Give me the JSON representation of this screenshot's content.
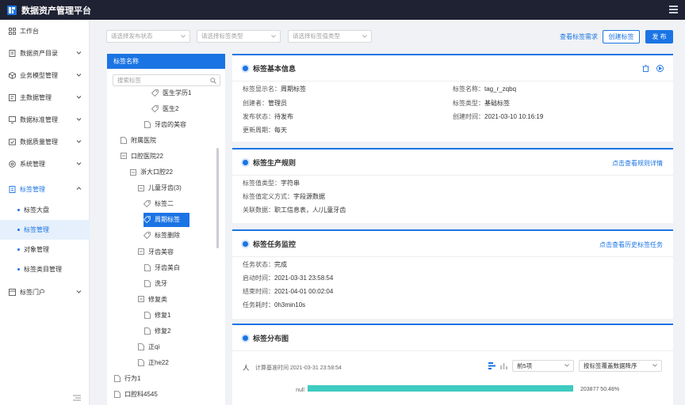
{
  "app": {
    "title": "数据资产管理平台"
  },
  "sidebar": {
    "items": [
      {
        "label": "工作台",
        "icon": "grid-icon",
        "has_children": false
      },
      {
        "label": "数据资产目录",
        "icon": "catalog-icon",
        "has_children": true
      },
      {
        "label": "业务模型管理",
        "icon": "cube-icon",
        "has_children": true
      },
      {
        "label": "主数据管理",
        "icon": "database-icon",
        "has_children": true
      },
      {
        "label": "数据标准管理",
        "icon": "monitor-icon",
        "has_children": true
      },
      {
        "label": "数据质量管理",
        "icon": "quality-icon",
        "has_children": true
      },
      {
        "label": "系统管理",
        "icon": "gear-icon",
        "has_children": true
      },
      {
        "label": "标签管理",
        "icon": "tag-icon",
        "has_children": true,
        "open": true
      },
      {
        "label": "标签门户",
        "icon": "portal-icon",
        "has_children": true
      }
    ],
    "sub_items": [
      {
        "label": "标签大盘",
        "active": false
      },
      {
        "label": "标签管理",
        "active": true
      },
      {
        "label": "对象管理",
        "active": false
      },
      {
        "label": "标签类目管理",
        "active": false
      }
    ]
  },
  "filters": {
    "status_placeholder": "请选择发布状态",
    "tag_type_placeholder": "请选择标签类型",
    "value_type_placeholder": "请选择标签值类型",
    "view_requests": "查看标签需求",
    "create_tag": "创建标签",
    "publish": "发 布"
  },
  "tree": {
    "header": "标签名称",
    "search_placeholder": "搜索标签",
    "nodes": [
      {
        "label": "医生学历1",
        "icon": "tag-icon",
        "depth": 5
      },
      {
        "label": "医生2",
        "icon": "tag-icon",
        "depth": 5
      },
      {
        "label": "牙齿的美容",
        "icon": "file-icon",
        "depth": 4
      },
      {
        "label": "附属医院",
        "icon": "file-icon",
        "depth": 1
      },
      {
        "label": "口腔医院22",
        "icon": "minus-square-icon",
        "depth": 1
      },
      {
        "label": "浙大口腔22",
        "icon": "minus-square-icon",
        "depth": 2
      },
      {
        "label": "儿童牙齿(3)",
        "icon": "minus-square-icon",
        "depth": 3
      },
      {
        "label": "标签二",
        "icon": "tag-icon",
        "depth": 4
      },
      {
        "label": "周期标签",
        "icon": "tag-icon",
        "depth": 4,
        "selected": true
      },
      {
        "label": "标签删除",
        "icon": "tag-icon",
        "depth": 4
      },
      {
        "label": "牙齿美容",
        "icon": "minus-square-icon",
        "depth": 3
      },
      {
        "label": "牙齿美白",
        "icon": "file-icon",
        "depth": 4
      },
      {
        "label": "洗牙",
        "icon": "file-icon",
        "depth": 4
      },
      {
        "label": "修复类",
        "icon": "minus-square-icon",
        "depth": 3
      },
      {
        "label": "修复1",
        "icon": "file-icon",
        "depth": 4
      },
      {
        "label": "修复2",
        "icon": "file-icon",
        "depth": 4
      },
      {
        "label": "正qi",
        "icon": "file-icon",
        "depth": 3
      },
      {
        "label": "正he22",
        "icon": "file-icon",
        "depth": 3
      },
      {
        "label": "行为1",
        "icon": "file-icon",
        "depth": 0
      },
      {
        "label": "口腔科4545",
        "icon": "file-icon",
        "depth": 0
      }
    ]
  },
  "basic_info": {
    "title": "标签基本信息",
    "display_name_label": "标签显示名：",
    "display_name": "周期标签",
    "name_label": "标签名称：",
    "name": "tag_r_zqbq",
    "creator_label": "创建者：",
    "creator": "管理员",
    "type_label": "标签类型：",
    "type": "基础标签",
    "status_label": "发布状态：",
    "status": "待发布",
    "created_label": "创建时间：",
    "created": "2021-03-10 10:16:19",
    "cycle_label": "更新周期：",
    "cycle": "每天"
  },
  "rules": {
    "title": "标签生产规则",
    "link": "点击查看规则详情",
    "value_type_label": "标签值类型：",
    "value_type": "字符串",
    "define_label": "标签值定义方式：",
    "define": "字段源数据",
    "assoc_label": "关联数据：",
    "assoc": "职工信息表，人/儿童牙齿"
  },
  "monitor": {
    "title": "标签任务监控",
    "link": "点击查看历史标签任务",
    "state_label": "任务状态：",
    "state": "完成",
    "start_label": "启动时间：",
    "start": "2021-03-31 23:58:54",
    "end_label": "结束时间：",
    "end": "2021-04-01 00:02:04",
    "cost_label": "任务耗时：",
    "cost": "0h3min10s"
  },
  "distribution": {
    "title": "标签分布图",
    "unit": "人",
    "calc_time": "计算基准时间 2021-03-31 23:58:54",
    "top_select": "前5项",
    "sort_select": "按标签覆盖数据降序"
  },
  "chart_data": {
    "type": "bar",
    "orientation": "horizontal",
    "categories": [
      "null"
    ],
    "values": [
      203877
    ],
    "percent_labels": [
      "50.48%"
    ],
    "color": "#3ecbc0"
  },
  "colors": {
    "accent": "#1b74e4",
    "topbar": "#1e2233",
    "bar": "#3ecbc0"
  }
}
